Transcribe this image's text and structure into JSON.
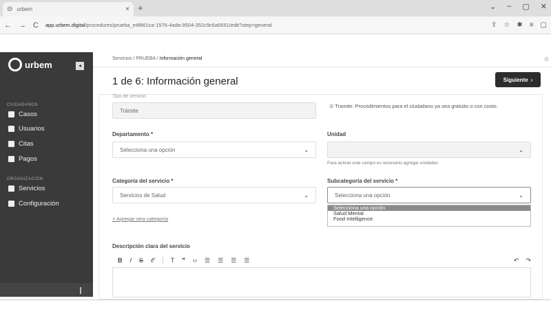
{
  "browser": {
    "tab_title": "urbem",
    "tab_close": "×",
    "new_tab": "+",
    "window_controls": [
      "⌄",
      "–",
      "▢",
      "✕"
    ],
    "nav": [
      "←",
      "→",
      "C"
    ],
    "url_host": "app.urbem.digital",
    "url_path": "/procedures/prueba_e4f861ca-1576-4ada-9504-352c9c6a5651/edit?step=general",
    "icons": [
      "⇪",
      "☆",
      "✱",
      "≡",
      "▢"
    ]
  },
  "sidebar": {
    "logo_text": "urbem",
    "collapse_icon": "◂",
    "section_1": "CIUDADANOS",
    "section_2": "ORGANIZACIÓN",
    "items": [
      {
        "label": "Casos",
        "icon": "briefcase-icon"
      },
      {
        "label": "Usuarios",
        "icon": "user-icon"
      },
      {
        "label": "Citas",
        "icon": "calendar-icon"
      },
      {
        "label": "Pagos",
        "icon": "payments-icon"
      },
      {
        "label": "Servicios",
        "icon": "services-icon"
      },
      {
        "label": "Configuración",
        "icon": "gear-icon"
      }
    ]
  },
  "header": {
    "breadcrumb_1": "Servicios",
    "breadcrumb_2": "PRUEBA",
    "breadcrumb_3": "Información general",
    "bell": "⌂",
    "title": "1 de 6: Información general",
    "next_button": "Siguiente",
    "next_arrow": "›"
  },
  "form": {
    "tipo_label": "Tipo de servicio",
    "tipo_value": "Trámite",
    "tipo_info": "Tramite: Procedimientos para el ciudadano ya sea gratuito o con costo.",
    "tipo_info_icon": "⊙",
    "departamento_label": "Departamento *",
    "departamento_value": "Selecciona una opción",
    "unidad_label": "Unidad",
    "unidad_value": "",
    "unidad_hint": "Para activar este campo es necesario agregar unidades",
    "categoria_label": "Categoría del servicio *",
    "categoria_value": "Servicios de Salud",
    "subcategoria_label": "Subcategoría del servicio *",
    "subcategoria_value": "Selecciona una opción",
    "subcategoria_options": [
      "Selecciona una opción",
      "Salud Mental",
      "Food Intelligence"
    ],
    "agregar_link": "+ Agregar otra categoría",
    "descripcion_label": "Descripción clara del servicio",
    "toolbar": [
      "B",
      "I",
      "S",
      "𝒪",
      "T",
      "❞",
      "‹›",
      "☰",
      "☰",
      "☰",
      "☰"
    ],
    "undo": "↶",
    "redo": "↷",
    "chevron": "⌄"
  }
}
